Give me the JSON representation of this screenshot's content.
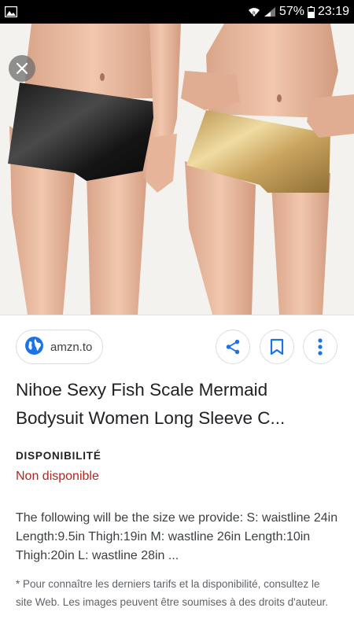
{
  "status_bar": {
    "battery": "57%",
    "time": "23:19",
    "icons": [
      "image-notification-icon",
      "wifi-icon",
      "signal-icon",
      "battery-icon"
    ]
  },
  "hero": {
    "close_icon": "close-icon"
  },
  "source": {
    "domain": "amzn.to",
    "icon": "globe-icon"
  },
  "actions": {
    "share_icon": "share-icon",
    "save_icon": "bookmark-icon",
    "more_icon": "more-vert-icon"
  },
  "product": {
    "title": "Nihoe Sexy Fish Scale Mermaid Bodysuit Women Long Sleeve C...",
    "availability_label": "DISPONIBILITÉ",
    "availability_value": "Non disponible",
    "description": "The following will be the size we provide: S: waistline 24in Length:9.5in Thigh:19in M: wastline 26in Length:10in Thigh:20in L: wastline 28in ...",
    "disclaimer": "* Pour connaître les derniers tarifs et la disponibilité, consultez le site Web. Les images peuvent être soumises à des droits d'auteur."
  },
  "colors": {
    "availability": "#b3261e",
    "accent": "#1a73e8"
  }
}
